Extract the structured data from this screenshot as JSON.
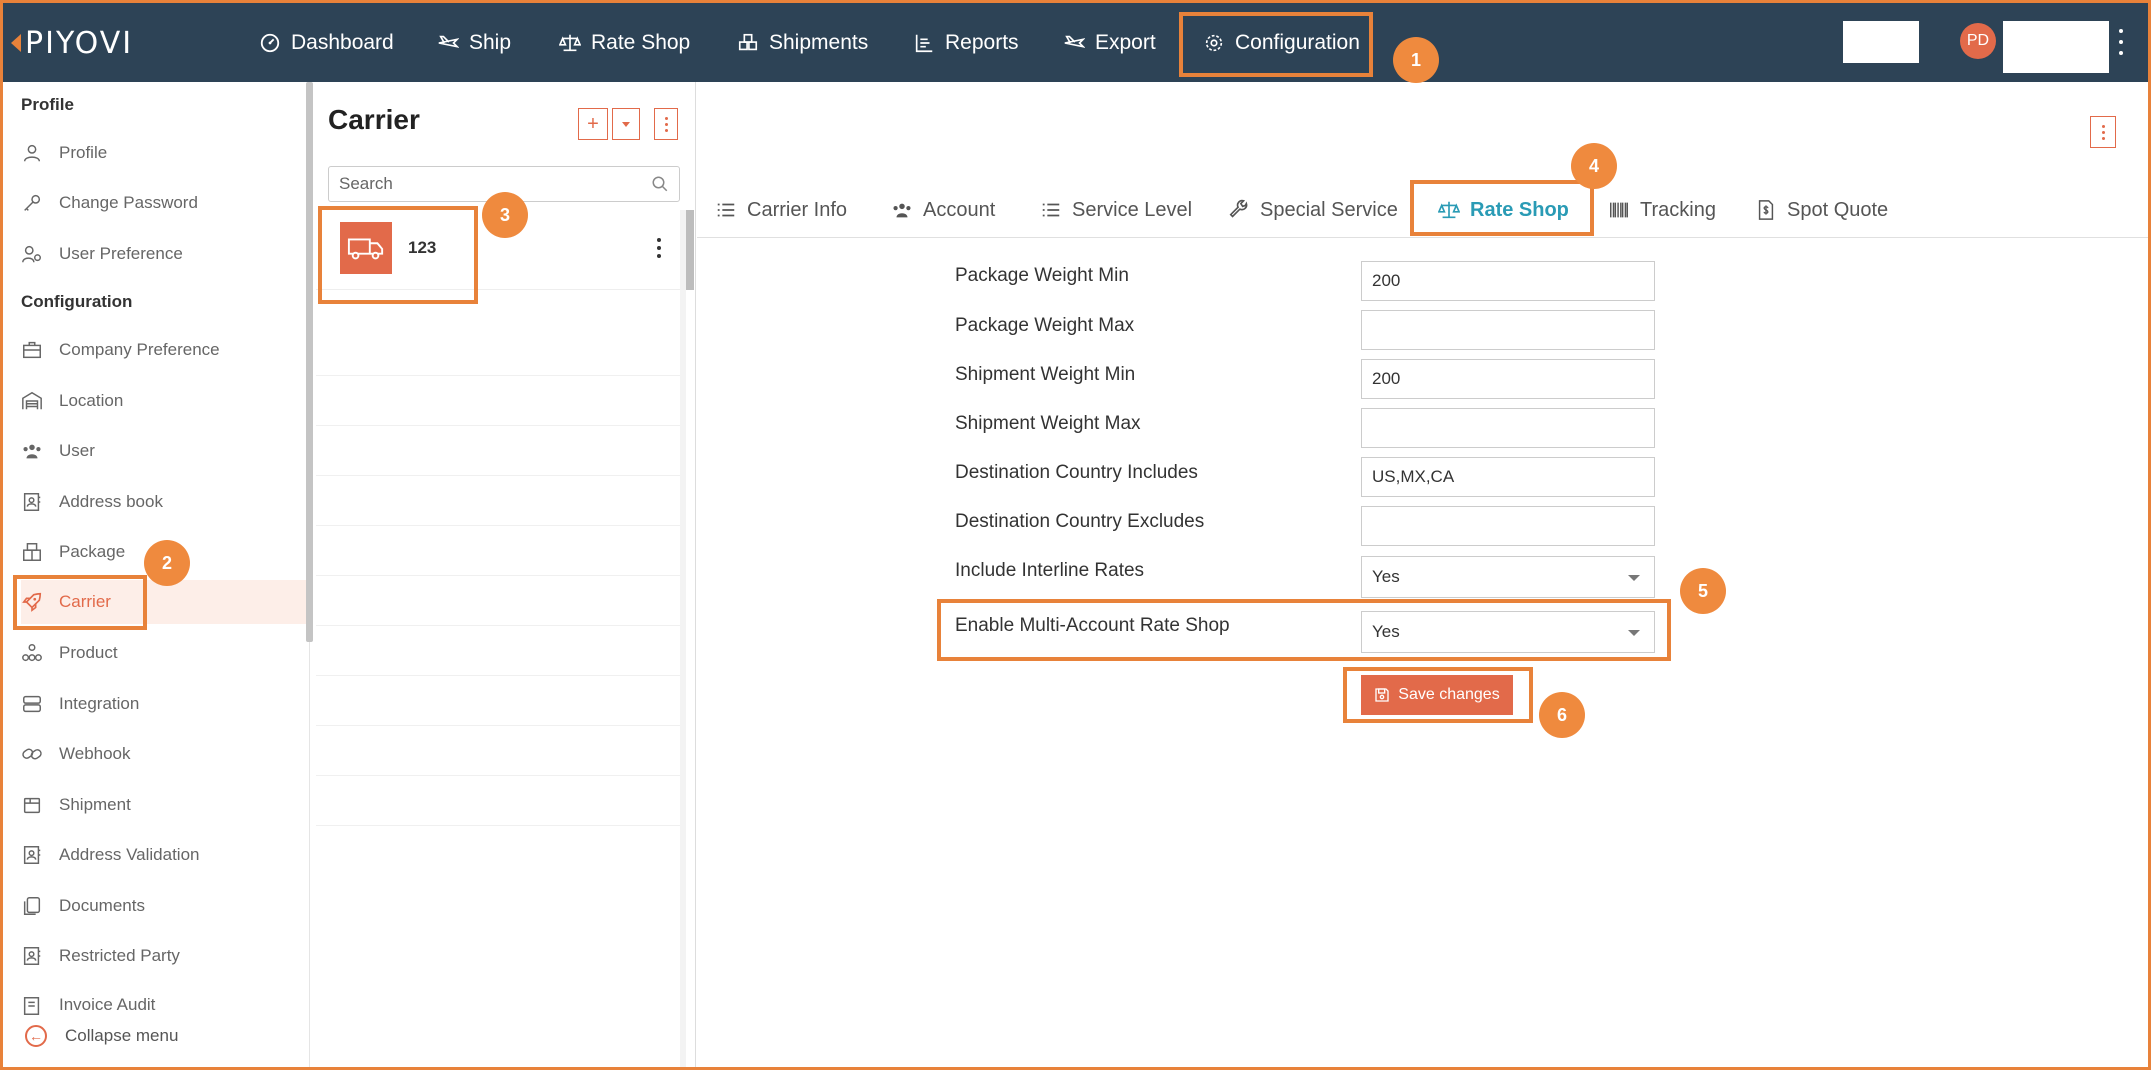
{
  "app": {
    "logo_text": "PIYOVI"
  },
  "navbar": {
    "items": [
      {
        "label": "Dashboard",
        "icon": "dashboard-icon"
      },
      {
        "label": "Ship",
        "icon": "plane-icon"
      },
      {
        "label": "Rate Shop",
        "icon": "scale-icon"
      },
      {
        "label": "Shipments",
        "icon": "boxes-icon"
      },
      {
        "label": "Reports",
        "icon": "reports-icon"
      },
      {
        "label": "Export",
        "icon": "export-plane-icon"
      },
      {
        "label": "Configuration",
        "icon": "gear-icon"
      }
    ],
    "active": "Configuration",
    "avatar_initials": "PD"
  },
  "steps": [
    "1",
    "2",
    "3",
    "4",
    "5",
    "6"
  ],
  "sidebar": {
    "section_profile": "Profile",
    "section_configuration": "Configuration",
    "profile_items": [
      {
        "label": "Profile",
        "icon": "user-icon"
      },
      {
        "label": "Change Password",
        "icon": "key-icon"
      },
      {
        "label": "User Preference",
        "icon": "user-settings-icon"
      }
    ],
    "config_items": [
      {
        "label": "Company Preference",
        "icon": "briefcase-icon"
      },
      {
        "label": "Location",
        "icon": "warehouse-icon"
      },
      {
        "label": "User",
        "icon": "users-icon"
      },
      {
        "label": "Address book",
        "icon": "address-book-icon"
      },
      {
        "label": "Package",
        "icon": "package-icon"
      },
      {
        "label": "Carrier",
        "icon": "rocket-icon"
      },
      {
        "label": "Product",
        "icon": "product-icon"
      },
      {
        "label": "Integration",
        "icon": "server-icon"
      },
      {
        "label": "Webhook",
        "icon": "link-icon"
      },
      {
        "label": "Shipment",
        "icon": "box-icon"
      },
      {
        "label": "Address Validation",
        "icon": "id-card-icon"
      },
      {
        "label": "Documents",
        "icon": "documents-icon"
      },
      {
        "label": "Restricted Party",
        "icon": "id-card-icon"
      },
      {
        "label": "Invoice Audit",
        "icon": "invoice-icon"
      }
    ],
    "active": "Carrier",
    "collapse_label": "Collapse menu"
  },
  "carrier_panel": {
    "title": "Carrier",
    "add_label": "+",
    "search_placeholder": "Search",
    "carriers": [
      {
        "name": "123"
      }
    ]
  },
  "main": {
    "tabs": [
      {
        "label": "Carrier Info",
        "icon": "list-icon"
      },
      {
        "label": "Account",
        "icon": "users-icon"
      },
      {
        "label": "Service Level",
        "icon": "list-icon"
      },
      {
        "label": "Special Service",
        "icon": "wrench-icon"
      },
      {
        "label": "Rate Shop",
        "icon": "scale-icon"
      },
      {
        "label": "Tracking",
        "icon": "barcode-icon"
      },
      {
        "label": "Spot Quote",
        "icon": "dollar-file-icon"
      }
    ],
    "active_tab": "Rate Shop",
    "form": {
      "package_weight_min": {
        "label": "Package Weight Min",
        "value": "200"
      },
      "package_weight_max": {
        "label": "Package Weight Max",
        "value": ""
      },
      "shipment_weight_min": {
        "label": "Shipment Weight Min",
        "value": "200"
      },
      "shipment_weight_max": {
        "label": "Shipment Weight Max",
        "value": ""
      },
      "dest_includes": {
        "label": "Destination Country Includes",
        "value": "US,MX,CA"
      },
      "dest_excludes": {
        "label": "Destination Country Excludes",
        "value": ""
      },
      "interline": {
        "label": "Include Interline Rates",
        "value": "Yes"
      },
      "multi_account": {
        "label": "Enable Multi-Account Rate Shop",
        "value": "Yes"
      }
    },
    "save_label": "Save changes"
  },
  "colors": {
    "navbar": "#2d4356",
    "accent": "#e26a4a",
    "highlight": "#e8823a",
    "active_tab": "#2a9bb5"
  }
}
